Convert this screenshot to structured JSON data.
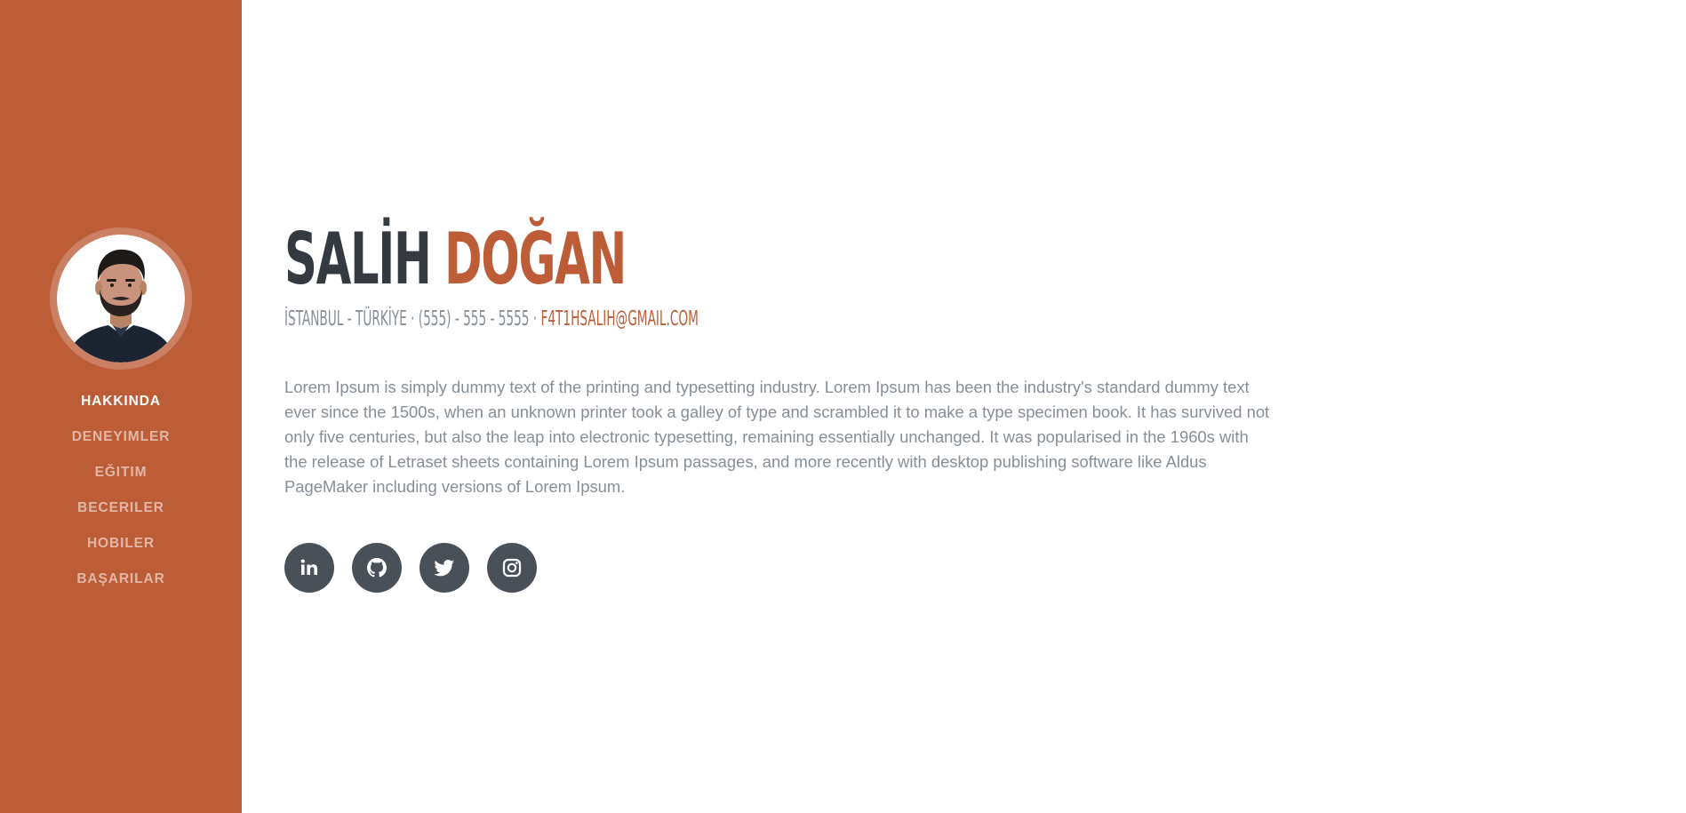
{
  "colors": {
    "primary": "#bd5d38",
    "dark": "#343a40",
    "muted": "#868e96",
    "social_bg": "#495057"
  },
  "profile": {
    "photo_alt": "profile photo"
  },
  "nav": {
    "items": [
      {
        "label": "HAKKINDA",
        "active": true
      },
      {
        "label": "DENEYIMLER",
        "active": false
      },
      {
        "label": "EĞITIM",
        "active": false
      },
      {
        "label": "BECERILER",
        "active": false
      },
      {
        "label": "HOBILER",
        "active": false
      },
      {
        "label": "BAŞARILAR",
        "active": false
      }
    ]
  },
  "about": {
    "first_name": "SALİH",
    "last_name": "DOĞAN",
    "contact_text": "İSTANBUL - TÜRKİYE · (555) - 555 - 5555 · ",
    "email": "F4T1HSALIH@GMAIL.COM",
    "lead": "Lorem Ipsum is simply dummy text of the printing and typesetting industry. Lorem Ipsum has been the industry's standard dummy text ever since the 1500s, when an unknown printer took a galley of type and scrambled it to make a type specimen book. It has survived not only five centuries, but also the leap into electronic typesetting, remaining essentially unchanged. It was popularised in the 1960s with the release of Letraset sheets containing Lorem Ipsum passages, and more recently with desktop publishing software like Aldus PageMaker including versions of Lorem Ipsum."
  },
  "social": [
    {
      "icon": "linkedin-icon"
    },
    {
      "icon": "github-icon"
    },
    {
      "icon": "twitter-icon"
    },
    {
      "icon": "instagram-icon"
    }
  ]
}
